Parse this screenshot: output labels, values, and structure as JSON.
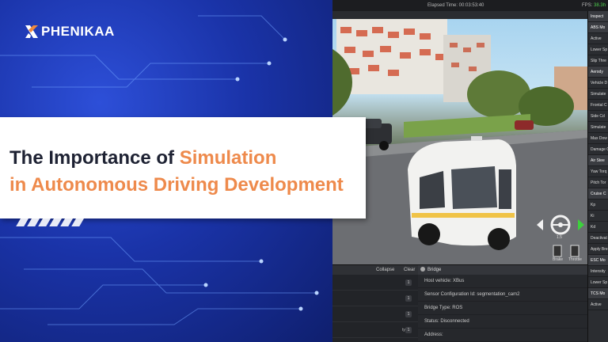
{
  "brand": {
    "logo_text": "PHENIKAA"
  },
  "title": {
    "line1_prefix": "The Importance of ",
    "line1_accent": "Simulation",
    "line2": "in Autonomous Driving Development"
  },
  "simulator": {
    "elapsed_time": "Elapsed Time: 00:03:53:40",
    "fps_label": "FPS:",
    "fps_value": "38.3h",
    "hud_speed_label": "1.5",
    "hud_brake_label": "Brake",
    "hud_throttle_label": "Throttle"
  },
  "inspector": {
    "title": "Inspect",
    "rows": [
      {
        "label": "ABS Mo",
        "type": "hdr"
      },
      {
        "label": "Active",
        "type": "row"
      },
      {
        "label": "Lower Sp",
        "type": "row"
      },
      {
        "label": "Slip Thre",
        "type": "row"
      },
      {
        "label": "Aerody",
        "type": "hdr"
      },
      {
        "label": "Vehicle D",
        "type": "row"
      },
      {
        "label": "Simulate",
        "type": "row"
      },
      {
        "label": "Frontal C",
        "type": "row"
      },
      {
        "label": "Side Cd",
        "type": "row"
      },
      {
        "label": "Simulate",
        "type": "row"
      },
      {
        "label": "Max Dow",
        "type": "row"
      },
      {
        "label": "Damage C",
        "type": "row"
      },
      {
        "label": "Air Stee",
        "type": "hdr"
      },
      {
        "label": "Yaw Torq",
        "type": "row"
      },
      {
        "label": "Pitch Tor",
        "type": "row"
      },
      {
        "label": "Cruise C",
        "type": "hdr"
      },
      {
        "label": "Kp",
        "type": "row"
      },
      {
        "label": "Ki",
        "type": "row"
      },
      {
        "label": "Kd",
        "type": "row"
      },
      {
        "label": "Deactivat",
        "type": "row"
      },
      {
        "label": "Apply Bre",
        "type": "row"
      },
      {
        "label": "ESC Mo",
        "type": "hdr"
      },
      {
        "label": "Intensity",
        "type": "row"
      },
      {
        "label": "Lower Sp",
        "type": "row"
      },
      {
        "label": "TCS Mo",
        "type": "hdr"
      },
      {
        "label": "Active",
        "type": "row"
      }
    ]
  },
  "log_panel": {
    "collapse_label": "Collapse",
    "clear_label": "Clear",
    "lines": [
      {
        "text": "",
        "count": "1"
      },
      {
        "text": "",
        "count": "1"
      },
      {
        "text": "",
        "count": "1"
      },
      {
        "text": "type",
        "count": "1"
      }
    ]
  },
  "bridge": {
    "title": "Bridge",
    "host_vehicle": "Host vehicle:  XBus",
    "sensor_config": "Sensor Configuration Id:  segmentation_cam2",
    "bridge_type": "Bridge Type:  ROS",
    "status": "Status:  Disconnected",
    "address": "Address:"
  }
}
